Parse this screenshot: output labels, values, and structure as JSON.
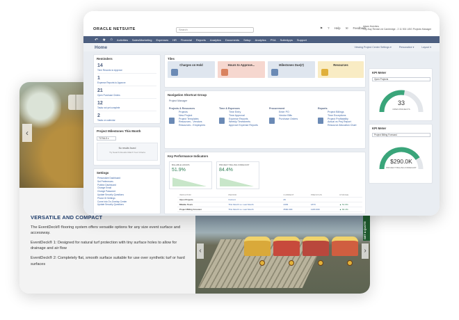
{
  "product": {
    "heading": "VERSATILE AND COMPACT",
    "paragraphs": [
      "The EventDeck® flooring system offers versatile options for any size event surface and accessway.",
      "EventDeck® 1: Designed for natural turf protection with tiny surface holes to allow for drainage and air flow",
      "EventDeck® 2: Completely flat, smooth surface suitable for use over synthetic turf or hard surfaces"
    ],
    "tab_label": "GET A QUOTE"
  },
  "header": {
    "logo": "ORACLE NETSUITE",
    "search_placeholder": "Search",
    "help": "Help",
    "feedback": "Feedback",
    "user_name": "Adam Hutchins",
    "user_role": "Fey-Kay Rental Ltd Cambridge - 2 11 501 USG Projects Manager"
  },
  "nav": {
    "items": [
      "Activities",
      "Sales/Marketing",
      "Expenses",
      "HR",
      "Financial",
      "Reports",
      "Analytics",
      "Documents",
      "Setup",
      "Analytics",
      "PSA",
      "SuiteApps",
      "Support"
    ]
  },
  "page": {
    "title": "Home",
    "links": [
      "Viewing Project Center Settings ▾",
      "Personalize ▾",
      "Layout ▾"
    ]
  },
  "reminders": {
    "title": "Reminders",
    "items": [
      {
        "count": "14",
        "label": "Time Records to Approve"
      },
      {
        "count": "1",
        "label": "Expense Reports to Approve"
      },
      {
        "count": "21",
        "label": "Open Purchase Orders"
      },
      {
        "count": "12",
        "label": "Tasks not yet complete"
      },
      {
        "count": "2",
        "label": "Tasks on calendar"
      }
    ]
  },
  "milestones": {
    "title": "Project Milestones This Month",
    "filter": "TOTALS ▾",
    "empty_title": "No results found",
    "empty_desc": "Try Search Results Match Your Criteria"
  },
  "settings": {
    "title": "Settings",
    "links": [
      "Personalize Dashboard",
      "Set Preferences",
      "Publish Dashboard",
      "Change Email",
      "Change Password",
      "Update Security Questions",
      "Phone ID Settings",
      "Come into On-Overlap Center",
      "Update Security Questions"
    ]
  },
  "tiles": {
    "title": "Tiles",
    "items": [
      {
        "label": "Charges on Hold",
        "color": "#dfe6ef",
        "icon_color": "#6b8ab5"
      },
      {
        "label": "Hours to Approve...",
        "color": "#f6d7cf",
        "icon_color": "#d9825f"
      },
      {
        "label": "Milestones Due(#)",
        "color": "#dfe6ef",
        "icon_color": "#6b8ab5"
      },
      {
        "label": "Resources",
        "color": "#f9ecc4",
        "icon_color": "#e0b03b"
      }
    ]
  },
  "shortcuts": {
    "title": "Navigation Shortcut Group",
    "project_manager": "Project Manager",
    "groups": [
      {
        "heading": "Projects & Resources",
        "links": [
          "Projects",
          "New Project",
          "Project Templates",
          "Resources - Vendors",
          "Resources - Employees"
        ]
      },
      {
        "heading": "Time & Expenses",
        "links": [
          "Time Entry",
          "Time Approval",
          "Expense Reports",
          "Weekly Timesheets",
          "Approve Expense Reports"
        ]
      },
      {
        "heading": "Procurement",
        "links": [
          "Enter PO",
          "Vendor Bills",
          "Purchase Orders"
        ]
      },
      {
        "heading": "Reports",
        "links": [
          "Project Billings",
          "Time Exceptions",
          "Project Profitability",
          "Actual vs Proj Report",
          "Resource Allocation Chart"
        ]
      }
    ]
  },
  "kpi_indicators": {
    "title": "Key Performance Indicators",
    "cards": [
      {
        "label": "BILLABLE HOURS",
        "value": "51.9%"
      },
      {
        "label": "PROJECT BILLING FORECAST",
        "value": "84.4%"
      }
    ],
    "columns": [
      "INDICATOR",
      "PERIOD",
      "CURRENT",
      "PREVIOUS",
      "CHANGE"
    ],
    "rows": [
      {
        "indicator": "Open Projects",
        "period": "Current",
        "current": "26",
        "previous": "",
        "change": ""
      },
      {
        "indicator": "Billable Hours",
        "period": "This Month vs. Last Month",
        "current": "3453",
        "previous": "1873",
        "change": "▲ 51.9%"
      },
      {
        "indicator": "Project Billing Forecast",
        "period": "This Month vs. Last Month",
        "current": "3590.00K",
        "previous": "1183.99K",
        "change": "▲ 84.4%"
      }
    ]
  },
  "kpi_meters": [
    {
      "title": "KPI Meter",
      "select": "Open Projects",
      "value": "33",
      "caption": "OPEN PROJECTS",
      "fraction": 0.55,
      "color": "#3aa57a"
    },
    {
      "title": "KPI Meter",
      "select": "Project Billing Forecast",
      "value": "$290.0K",
      "caption": "PROJECT BILLING FORECAST",
      "fraction": 0.82,
      "color": "#3aa57a"
    }
  ]
}
